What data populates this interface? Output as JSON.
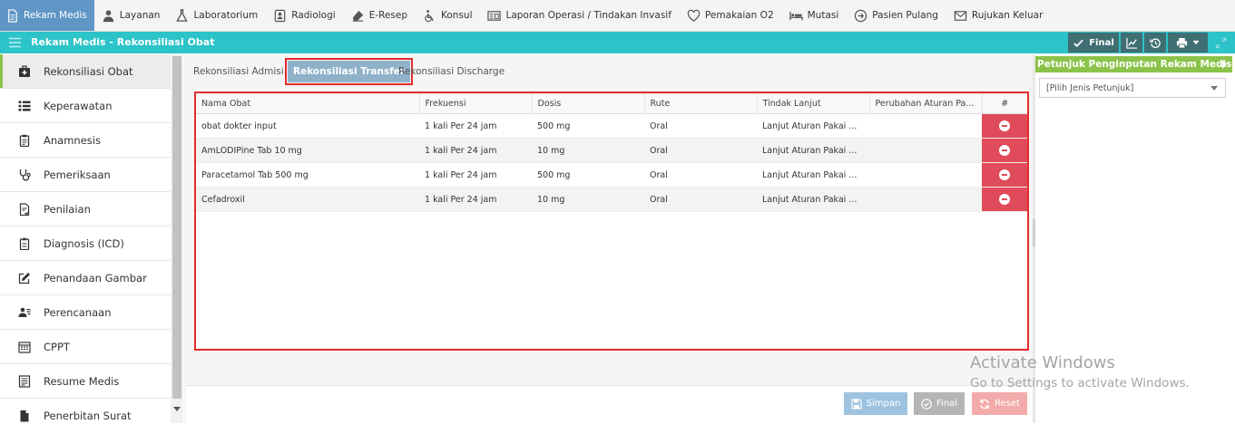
{
  "topnav": {
    "items": [
      {
        "label": "Rekam Medis",
        "icon": "document-icon",
        "active": true
      },
      {
        "label": "Layanan",
        "icon": "user-icon"
      },
      {
        "label": "Laboratorium",
        "icon": "flask-icon"
      },
      {
        "label": "Radiologi",
        "icon": "radiology-icon"
      },
      {
        "label": "E-Resep",
        "icon": "eraser-icon"
      },
      {
        "label": "Konsul",
        "icon": "wheelchair-icon"
      },
      {
        "label": "Laporan Operasi / Tindakan Invasif",
        "icon": "report-icon"
      },
      {
        "label": "Pemakaian O2",
        "icon": "heart-icon"
      },
      {
        "label": "Mutasi",
        "icon": "bed-icon"
      },
      {
        "label": "Pasien Pulang",
        "icon": "arrow-circle-icon"
      },
      {
        "label": "Rujukan Keluar",
        "icon": "envelope-icon"
      }
    ]
  },
  "titlebar": {
    "title": "Rekam Medis - Rekonsiliasi Obat",
    "final_label": "Final"
  },
  "sidebar": {
    "items": [
      {
        "label": "Rekonsiliasi Obat",
        "icon": "medkit-icon",
        "active": true
      },
      {
        "label": "Keperawatan",
        "icon": "list-icon"
      },
      {
        "label": "Anamnesis",
        "icon": "clipboard-icon"
      },
      {
        "label": "Pemeriksaan",
        "icon": "stethoscope-icon"
      },
      {
        "label": "Penilaian",
        "icon": "file-check-icon"
      },
      {
        "label": "Diagnosis (ICD)",
        "icon": "clipboard-list-icon"
      },
      {
        "label": "Penandaan Gambar",
        "icon": "edit-icon"
      },
      {
        "label": "Perencanaan",
        "icon": "users-icon"
      },
      {
        "label": "CPPT",
        "icon": "calendar-icon"
      },
      {
        "label": "Resume Medis",
        "icon": "form-icon"
      },
      {
        "label": "Penerbitan Surat",
        "icon": "file-icon"
      }
    ]
  },
  "tabs": [
    {
      "label": "Rekonsiliasi Admisi"
    },
    {
      "label": "Rekonsiliasi Transfer",
      "active": true
    },
    {
      "label": "Rekonsiliasi Discharge"
    }
  ],
  "table": {
    "columns": [
      "Nama Obat",
      "Frekuensi",
      "Dosis",
      "Rute",
      "Tindak Lanjut",
      "Perubahan Aturan Pa...",
      "#"
    ],
    "rows": [
      [
        "obat dokter input",
        "1 kali Per 24 jam",
        "500 mg",
        "Oral",
        "Lanjut Aturan Pakai ...",
        ""
      ],
      [
        "AmLODIPine Tab 10 mg",
        "1 kali Per 24 jam",
        "10 mg",
        "Oral",
        "Lanjut Aturan Pakai ...",
        ""
      ],
      [
        "Paracetamol Tab 500 mg",
        "1 kali Per 24 jam",
        "500 mg",
        "Oral",
        "Lanjut Aturan Pakai ...",
        ""
      ],
      [
        "Cefadroxil",
        "1 kali Per 24 jam",
        "10 mg",
        "Oral",
        "Lanjut Aturan Pakai ...",
        ""
      ]
    ]
  },
  "footer": {
    "save_label": "Simpan",
    "final_label": "Final",
    "reset_label": "Reset"
  },
  "right_panel": {
    "title": "Petunjuk Penginputan Rekam Medis",
    "select_value": "[Pilih Jenis Petunjuk]"
  },
  "watermark": {
    "title": "Activate Windows",
    "subtitle": "Go to Settings to activate Windows."
  },
  "colors": {
    "nav_active": "#5f96c5",
    "titlebar": "#2cc3c9",
    "accent_green": "#8bc34a",
    "highlight_red": "#e32b2b",
    "delete_red": "#e04b5b"
  }
}
